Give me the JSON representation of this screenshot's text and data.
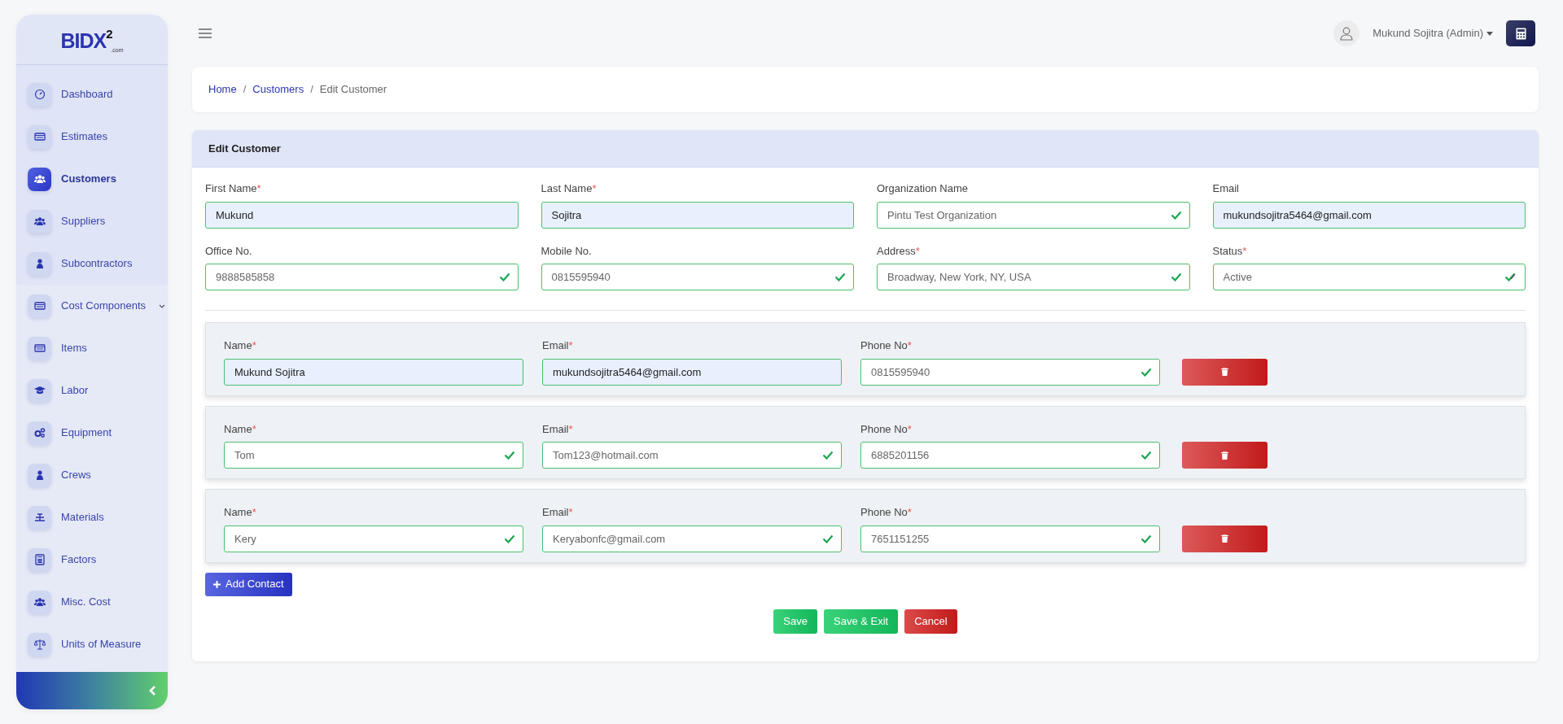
{
  "sidebar": {
    "logo": {
      "text": "BIDX",
      "sup": "2",
      "sub": ".com"
    },
    "items": [
      {
        "label": "Dashboard",
        "selected": false
      },
      {
        "label": "Estimates",
        "selected": false
      },
      {
        "label": "Customers",
        "selected": true
      },
      {
        "label": "Suppliers",
        "selected": false
      },
      {
        "label": "Subcontractors",
        "selected": false
      },
      {
        "label": "Cost Components",
        "selected": false,
        "expanded": true,
        "children": [
          {
            "label": "Items",
            "selected": false
          },
          {
            "label": "Labor",
            "selected": false
          },
          {
            "label": "Equipment",
            "selected": false
          },
          {
            "label": "Crews",
            "selected": false
          },
          {
            "label": "Materials",
            "selected": false
          },
          {
            "label": "Factors",
            "selected": false
          },
          {
            "label": "Misc. Cost",
            "selected": false
          },
          {
            "label": "Units of Measure",
            "selected": false
          }
        ]
      }
    ]
  },
  "topbar": {
    "user": "Mukund Sojitra (Admin)"
  },
  "breadcrumb": [
    {
      "label": "Home",
      "current": false
    },
    {
      "separator": "/",
      "label": "Customers",
      "current": false
    },
    {
      "separator": "/",
      "label": "Edit Customer",
      "current": true
    }
  ],
  "form": {
    "title": "Edit Customer",
    "fields": [
      {
        "kind": "text",
        "label": "First Name",
        "required_mark": "*",
        "value": "Mukund",
        "autofilled": true
      },
      {
        "kind": "text",
        "label": "Last Name",
        "required_mark": "*",
        "value": "Sojitra",
        "autofilled": true
      },
      {
        "kind": "text",
        "label": "Organization Name",
        "value": "Pintu Test Organization",
        "autofilled": false
      },
      {
        "kind": "text",
        "label": "Email",
        "value": "mukundsojitra5464@gmail.com",
        "autofilled": true
      },
      {
        "kind": "text",
        "label": "Office No.",
        "value": "9888585858",
        "autofilled": false
      },
      {
        "kind": "text",
        "label": "Mobile No.",
        "value": "0815595940",
        "autofilled": false
      },
      {
        "kind": "text",
        "label": "Address",
        "required_mark": "*",
        "value": "Broadway, New York, NY, USA",
        "autofilled": false
      },
      {
        "kind": "select",
        "label": "Status",
        "required_mark": "*",
        "value": "Active",
        "autofilled": false
      }
    ],
    "contacts": [
      {
        "fields": [
          {
            "label": "Name",
            "required_mark": "*",
            "value": "Mukund Sojitra",
            "autofilled": true
          },
          {
            "label": "Email",
            "required_mark": "*",
            "value": "mukundsojitra5464@gmail.com",
            "autofilled": true
          },
          {
            "label": "Phone No",
            "required_mark": "*",
            "value": "0815595940",
            "autofilled": false
          }
        ]
      },
      {
        "fields": [
          {
            "label": "Name",
            "required_mark": "*",
            "value": "Tom",
            "autofilled": false
          },
          {
            "label": "Email",
            "required_mark": "*",
            "value": "Tom123@hotmail.com",
            "autofilled": false
          },
          {
            "label": "Phone No",
            "required_mark": "*",
            "value": "6885201156",
            "autofilled": false
          }
        ]
      },
      {
        "fields": [
          {
            "label": "Name",
            "required_mark": "*",
            "value": "Kery",
            "autofilled": false
          },
          {
            "label": "Email",
            "required_mark": "*",
            "value": "Keryabonfc@gmail.com",
            "autofilled": false
          },
          {
            "label": "Phone No",
            "required_mark": "*",
            "value": "7651151255",
            "autofilled": false
          }
        ]
      }
    ],
    "add_button": "Add Contact",
    "actions": [
      {
        "kind": "save",
        "label": "Save"
      },
      {
        "kind": "save",
        "label": "Save & Exit"
      },
      {
        "kind": "cancel",
        "label": "Cancel"
      }
    ]
  }
}
